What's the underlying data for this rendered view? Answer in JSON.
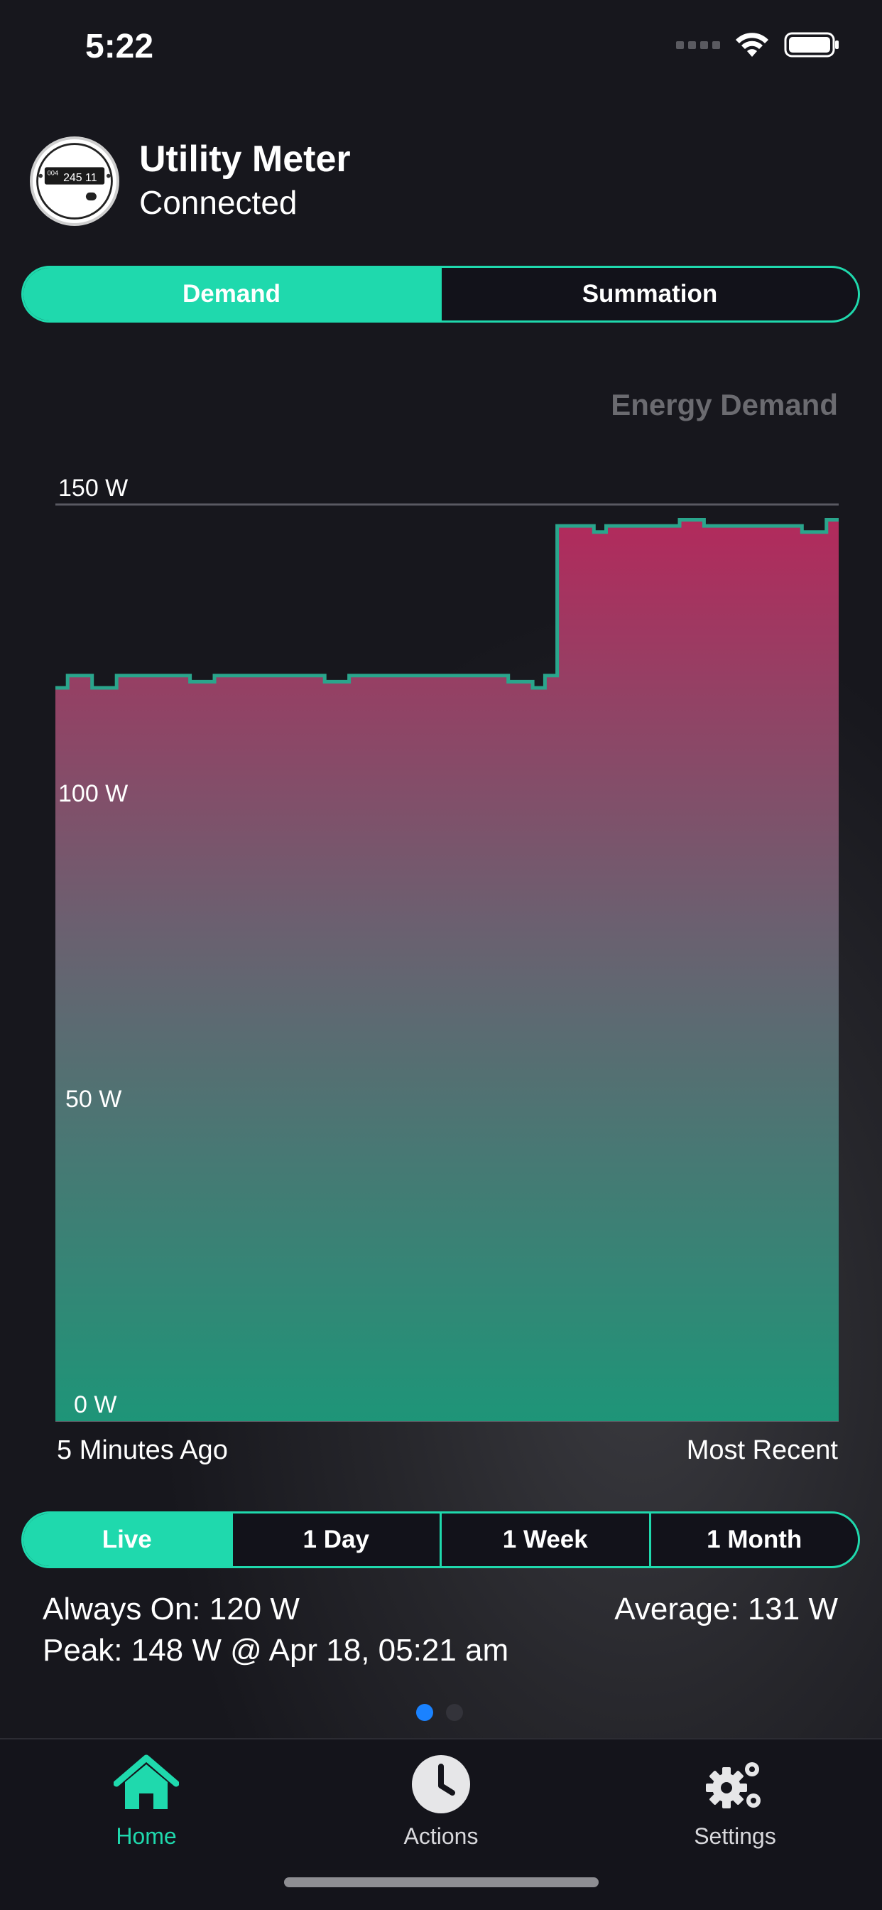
{
  "status_bar": {
    "time": "5:22"
  },
  "header": {
    "device_title": "Utility Meter",
    "device_status": "Connected",
    "meter_reading": "245 11",
    "meter_prefix": "004"
  },
  "view_tabs": [
    {
      "label": "Demand",
      "active": true
    },
    {
      "label": "Summation",
      "active": false
    }
  ],
  "chart_data": {
    "type": "area",
    "title": "Energy Demand",
    "ylim": [
      0,
      150
    ],
    "y_ticks": [
      "0 W",
      "50 W",
      "100 W",
      "150 W"
    ],
    "x_labels": [
      "5 Minutes Ago",
      "Most Recent"
    ],
    "values": [
      120,
      122,
      122,
      120,
      120,
      122,
      122,
      122,
      122,
      122,
      122,
      121,
      121,
      122,
      122,
      122,
      122,
      122,
      122,
      122,
      122,
      122,
      121,
      121,
      122,
      122,
      122,
      122,
      122,
      122,
      122,
      122,
      122,
      122,
      122,
      122,
      122,
      121,
      121,
      120,
      122,
      146.5,
      146.5,
      146.5,
      145.5,
      146.5,
      146.5,
      146.5,
      146.5,
      146.5,
      146.5,
      147.5,
      147.5,
      146.5,
      146.5,
      146.5,
      146.5,
      146.5,
      146.5,
      146.5,
      146.5,
      145.5,
      145.5,
      147.5
    ],
    "colors": {
      "line": "#2aa58c",
      "top": "#b22a5c",
      "mid": "#6b6070",
      "bottom": "#1e9578",
      "grid": "#5a5a62"
    }
  },
  "range_tabs": [
    {
      "label": "Live",
      "active": true
    },
    {
      "label": "1 Day",
      "active": false
    },
    {
      "label": "1 Week",
      "active": false
    },
    {
      "label": "1 Month",
      "active": false
    }
  ],
  "stats": {
    "always_on": "Always On: 120 W",
    "average": "Average: 131  W",
    "peak": "Peak: 148 W @ Apr 18, 05:21 am"
  },
  "pager": {
    "count": 2,
    "active": 0
  },
  "tabbar": {
    "home": "Home",
    "actions": "Actions",
    "settings": "Settings"
  },
  "colors": {
    "accent": "#1fd9ad",
    "page_dot_active": "#1a82ff"
  }
}
